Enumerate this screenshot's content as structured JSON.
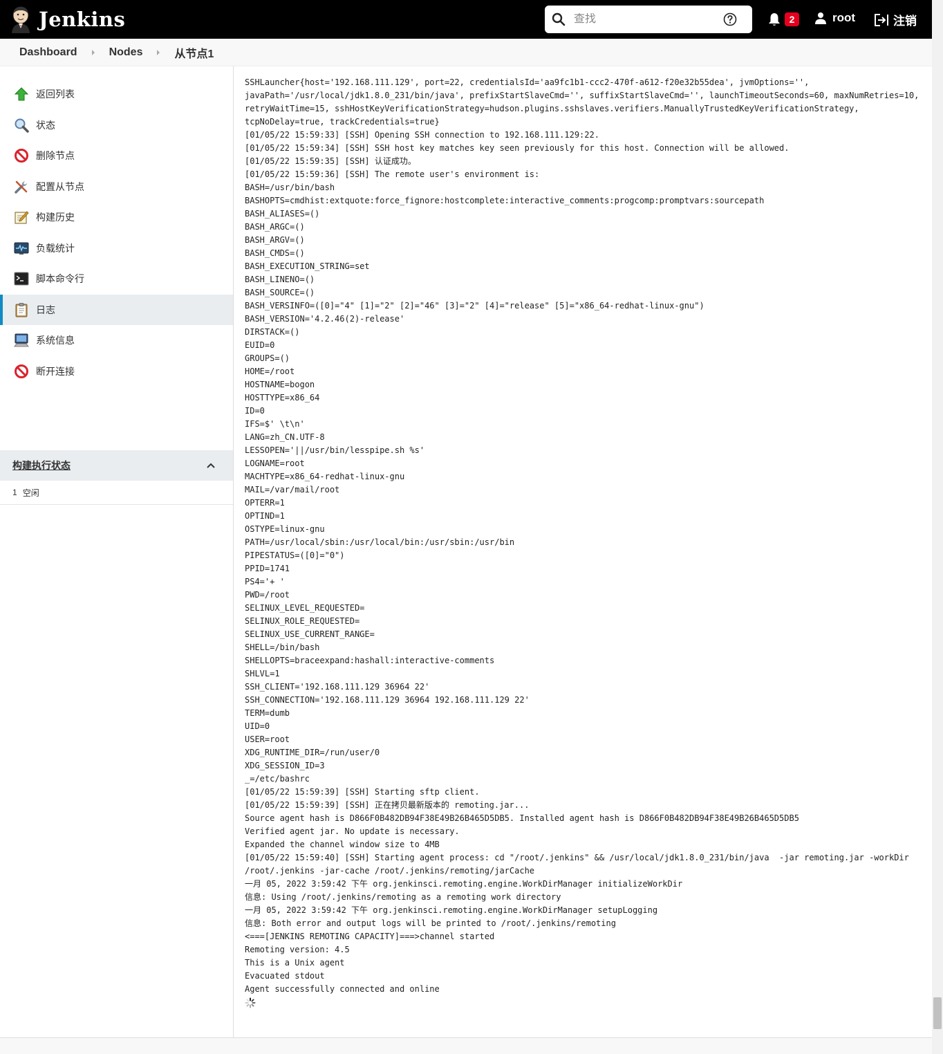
{
  "header": {
    "app_name": "Jenkins",
    "search_placeholder": "查找",
    "notification_count": "2",
    "user": "root",
    "logout": "注销"
  },
  "breadcrumb": [
    "Dashboard",
    "Nodes",
    "从节点1"
  ],
  "sidebar": {
    "items": [
      {
        "label": "返回列表",
        "icon": "arrow-up-icon"
      },
      {
        "label": "状态",
        "icon": "magnifier-icon"
      },
      {
        "label": "删除节点",
        "icon": "no-entry-icon"
      },
      {
        "label": "配置从节点",
        "icon": "tools-icon"
      },
      {
        "label": "构建历史",
        "icon": "notepad-icon"
      },
      {
        "label": "负载统计",
        "icon": "monitor-chart-icon"
      },
      {
        "label": "脚本命令行",
        "icon": "terminal-icon"
      },
      {
        "label": "日志",
        "icon": "clipboard-icon",
        "active": true
      },
      {
        "label": "系统信息",
        "icon": "computer-icon"
      },
      {
        "label": "断开连接",
        "icon": "no-entry-icon"
      }
    ],
    "executor_panel": {
      "title": "构建执行状态",
      "rows": [
        {
          "num": "1",
          "status": "空闲"
        }
      ]
    }
  },
  "log_lines": [
    "SSHLauncher{host='192.168.111.129', port=22, credentialsId='aa9fc1b1-ccc2-470f-a612-f20e32b55dea', jvmOptions='',",
    "javaPath='/usr/local/jdk1.8.0_231/bin/java', prefixStartSlaveCmd='', suffixStartSlaveCmd='', launchTimeoutSeconds=60, maxNumRetries=10,",
    "retryWaitTime=15, sshHostKeyVerificationStrategy=hudson.plugins.sshslaves.verifiers.ManuallyTrustedKeyVerificationStrategy,",
    "tcpNoDelay=true, trackCredentials=true}",
    "[01/05/22 15:59:33] [SSH] Opening SSH connection to 192.168.111.129:22.",
    "[01/05/22 15:59:34] [SSH] SSH host key matches key seen previously for this host. Connection will be allowed.",
    "[01/05/22 15:59:35] [SSH] 认证成功。",
    "[01/05/22 15:59:36] [SSH] The remote user's environment is:",
    "BASH=/usr/bin/bash",
    "BASHOPTS=cmdhist:extquote:force_fignore:hostcomplete:interactive_comments:progcomp:promptvars:sourcepath",
    "BASH_ALIASES=()",
    "BASH_ARGC=()",
    "BASH_ARGV=()",
    "BASH_CMDS=()",
    "BASH_EXECUTION_STRING=set",
    "BASH_LINENO=()",
    "BASH_SOURCE=()",
    "BASH_VERSINFO=([0]=\"4\" [1]=\"2\" [2]=\"46\" [3]=\"2\" [4]=\"release\" [5]=\"x86_64-redhat-linux-gnu\")",
    "BASH_VERSION='4.2.46(2)-release'",
    "DIRSTACK=()",
    "EUID=0",
    "GROUPS=()",
    "HOME=/root",
    "HOSTNAME=bogon",
    "HOSTTYPE=x86_64",
    "ID=0",
    "IFS=$' \\t\\n'",
    "LANG=zh_CN.UTF-8",
    "LESSOPEN='||/usr/bin/lesspipe.sh %s'",
    "LOGNAME=root",
    "MACHTYPE=x86_64-redhat-linux-gnu",
    "MAIL=/var/mail/root",
    "OPTERR=1",
    "OPTIND=1",
    "OSTYPE=linux-gnu",
    "PATH=/usr/local/sbin:/usr/local/bin:/usr/sbin:/usr/bin",
    "PIPESTATUS=([0]=\"0\")",
    "PPID=1741",
    "PS4='+ '",
    "PWD=/root",
    "SELINUX_LEVEL_REQUESTED=",
    "SELINUX_ROLE_REQUESTED=",
    "SELINUX_USE_CURRENT_RANGE=",
    "SHELL=/bin/bash",
    "SHELLOPTS=braceexpand:hashall:interactive-comments",
    "SHLVL=1",
    "SSH_CLIENT='192.168.111.129 36964 22'",
    "SSH_CONNECTION='192.168.111.129 36964 192.168.111.129 22'",
    "TERM=dumb",
    "UID=0",
    "USER=root",
    "XDG_RUNTIME_DIR=/run/user/0",
    "XDG_SESSION_ID=3",
    "_=/etc/bashrc",
    "[01/05/22 15:59:39] [SSH] Starting sftp client.",
    "[01/05/22 15:59:39] [SSH] 正在拷贝最新版本的 remoting.jar...",
    "Source agent hash is D866F0B482DB94F38E49B26B465D5DB5. Installed agent hash is D866F0B482DB94F38E49B26B465D5DB5",
    "Verified agent jar. No update is necessary.",
    "Expanded the channel window size to 4MB",
    "[01/05/22 15:59:40] [SSH] Starting agent process: cd \"/root/.jenkins\" && /usr/local/jdk1.8.0_231/bin/java  -jar remoting.jar -workDir",
    "/root/.jenkins -jar-cache /root/.jenkins/remoting/jarCache",
    "一月 05, 2022 3:59:42 下午 org.jenkinsci.remoting.engine.WorkDirManager initializeWorkDir",
    "信息: Using /root/.jenkins/remoting as a remoting work directory",
    "一月 05, 2022 3:59:42 下午 org.jenkinsci.remoting.engine.WorkDirManager setupLogging",
    "信息: Both error and output logs will be printed to /root/.jenkins/remoting",
    "<===[JENKINS REMOTING CAPACITY]===>channel started",
    "Remoting version: 4.5",
    "This is a Unix agent",
    "Evacuated stdout",
    "Agent successfully connected and online"
  ],
  "colors": {
    "header_bg": "#000000",
    "badge": "#e6001f",
    "active_accent": "#138ac4",
    "active_bg": "#e9edf0"
  }
}
